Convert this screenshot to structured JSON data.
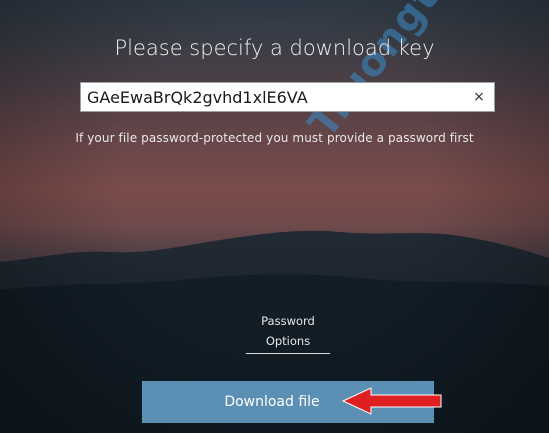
{
  "title": "Please specify a download key",
  "key_field": {
    "value": "GAeEwaBrQk2gvhd1xlE6VA",
    "clear_icon": "×"
  },
  "hint": "If your file password-protected you must provide a password first",
  "password_options": {
    "line1": "Password",
    "line2": "Options"
  },
  "download_button": {
    "label": "Download file"
  },
  "watermark": "Truongtin.top",
  "colors": {
    "button": "#5c8fb4",
    "arrow": "#e02020",
    "watermark": "#3c8cc8"
  },
  "icons": {
    "clear": "close-icon",
    "annotation": "arrow-left-icon"
  }
}
